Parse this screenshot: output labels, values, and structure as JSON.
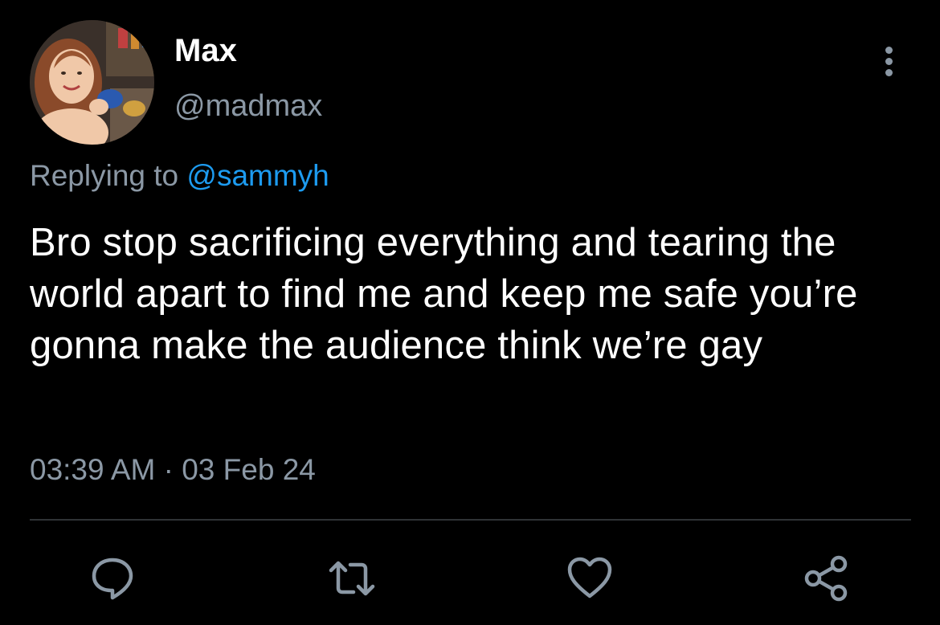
{
  "user": {
    "display_name": "Max",
    "handle": "@madmax",
    "avatar_icon": "profile-photo"
  },
  "reply": {
    "prefix": "Replying to ",
    "mention": "@sammyh"
  },
  "tweet": {
    "text": "Bro stop sacrificing everything and tearing the world apart to find me and keep me safe you’re gonna make the audience think we’re gay",
    "time": "03:39 AM",
    "separator": " · ",
    "date": "03 Feb 24"
  },
  "actions": [
    {
      "name": "reply",
      "icon": "comment-icon"
    },
    {
      "name": "retweet",
      "icon": "retweet-icon"
    },
    {
      "name": "like",
      "icon": "heart-icon"
    },
    {
      "name": "share",
      "icon": "share-icon"
    }
  ],
  "colors": {
    "background": "#000000",
    "text": "#ffffff",
    "secondary": "#8b98a5",
    "link": "#1d9bf0",
    "divider": "#2f3336"
  }
}
